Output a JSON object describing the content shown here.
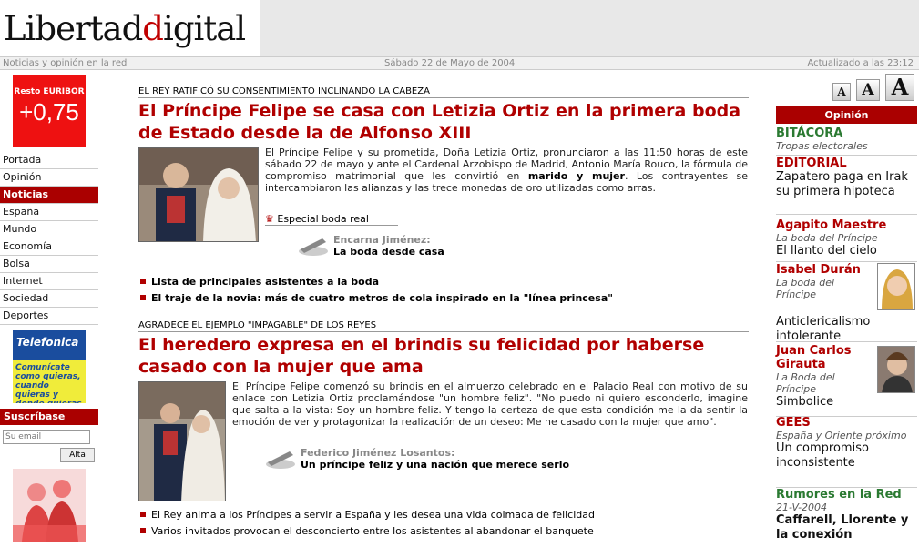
{
  "header": {
    "logo_part1": "Libertad",
    "logo_part2": "d",
    "logo_part3": "igital",
    "tagline": "Noticias y opinión en la red",
    "date": "Sábado 22 de Mayo de 2004",
    "updated": "Actualizado a las 23:12"
  },
  "euribor": {
    "label": "Resto EURIBOR",
    "value": "+0,75"
  },
  "nav": {
    "items": [
      "Portada",
      "Opinión",
      "Noticias",
      "España",
      "Mundo",
      "Economía",
      "Bolsa",
      "Internet",
      "Sociedad",
      "Deportes"
    ],
    "active_index": 2
  },
  "telefonica": {
    "logo": "Telefonica",
    "slogan": "Comunícate como quieras, cuando quieras y donde quieras"
  },
  "subscribe": {
    "title": "Suscríbase",
    "email_placeholder": "Su email",
    "button": "Alta"
  },
  "story1": {
    "kicker": "EL REY RATIFICÓ SU CONSENTIMIENTO INCLINANDO LA CABEZA",
    "headline": "El Príncipe Felipe se casa con Letizia Ortiz en la primera boda de Estado desde la de Alfonso XIII",
    "body_lead": "El Príncipe Felipe y su prometida, Doña Letizia Ortiz, pronunciaron a las 11:50 horas de este sábado 22 de mayo y ante el Cardenal Arzobispo de Madrid, Antonio María Rouco, la fórmula de compromiso matrimonial que les convirtió en ",
    "body_bold": "marido y mujer",
    "body_tail": ". Los contrayentes se intercambiaron las alianzas y las trece monedas de oro utilizadas como arras.",
    "special_label": "Especial boda real",
    "opinion_author": "Encarna Jiménez:",
    "opinion_title": "La boda desde casa",
    "bullets": [
      "Lista de principales asistentes a la boda",
      "El traje de la novia: más de cuatro metros de cola inspirado en la \"línea princesa\""
    ]
  },
  "story2": {
    "kicker": "AGRADECE EL EJEMPLO \"IMPAGABLE\" DE LOS REYES",
    "headline": "El heredero expresa en el brindis su felicidad por haberse casado con la mujer que ama",
    "body": "El Príncipe Felipe comenzó su brindis en el almuerzo celebrado en el Palacio Real con motivo de su enlace con Letizia Ortiz proclamándose \"un hombre feliz\". \"No puedo ni quiero esconderlo, imagine que salta a la vista: Soy un hombre feliz. Y tengo la certeza de que esta condición me la da sentir la emoción de ver y protagonizar la realización de un deseo: Me he casado con la mujer que amo\".",
    "opinion_author": "Federico Jiménez Losantos:",
    "opinion_title": "Un príncipe feliz y una nación que merece serlo",
    "bullets": [
      "El Rey anima a los Príncipes a servir a España y les desea una vida colmada de felicidad",
      "Varios invitados provocan el desconcierto entre los asistentes al abandonar el banquete"
    ]
  },
  "font_buttons": [
    "A",
    "A",
    "A"
  ],
  "opinion": {
    "header": "Opinión",
    "blocks": [
      {
        "name": "BITÁCORA",
        "sub": "Tropas electorales",
        "title": ""
      },
      {
        "name": "EDITORIAL",
        "sub": "",
        "title": "Zapatero paga en Irak su primera hipoteca"
      },
      {
        "name": "Agapito Maestre",
        "sub": "La boda del Príncipe",
        "title": "El llanto del cielo"
      },
      {
        "name": "Isabel Durán",
        "sub": "La boda del Príncipe",
        "title": "Anticlericalismo intolerante"
      },
      {
        "name": "Juan Carlos Girauta",
        "sub": "La Boda del Príncipe",
        "title": "Simbolice"
      },
      {
        "name": "GEES",
        "sub": "España y Oriente próximo",
        "title": "Un compromiso inconsistente"
      },
      {
        "name": "Rumores en la Red",
        "sub": "21-V-2004",
        "title": "Caffarell, Llorente y la conexión"
      }
    ]
  },
  "colors": {
    "brand_red": "#b00000",
    "nav_red": "#aa0000",
    "green": "#2b7a32",
    "telefonica_blue": "#1a4d9e",
    "telefonica_yellow": "#f0ec3a"
  }
}
